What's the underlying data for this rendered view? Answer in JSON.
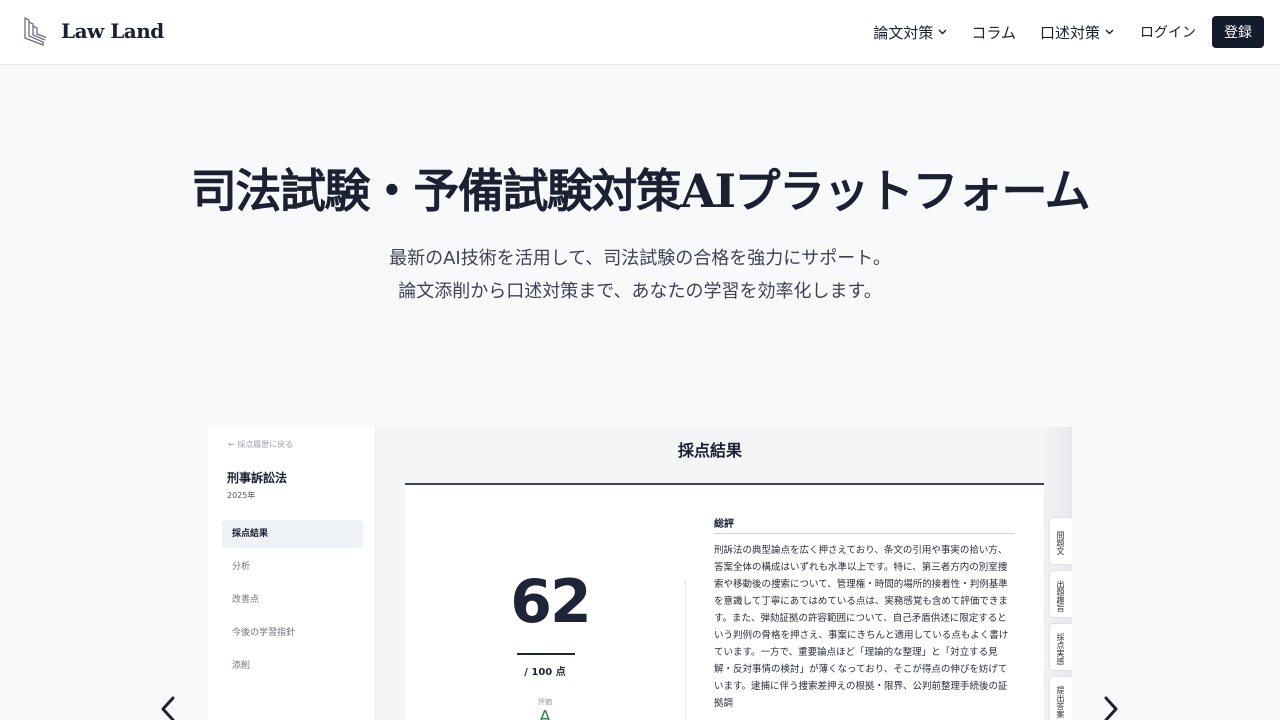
{
  "brand": {
    "name": "Law Land"
  },
  "nav": {
    "items": [
      {
        "label": "論文対策",
        "has_dropdown": true
      },
      {
        "label": "コラム",
        "has_dropdown": false
      },
      {
        "label": "口述対策",
        "has_dropdown": true
      }
    ],
    "login_label": "ログイン",
    "register_label": "登録"
  },
  "hero": {
    "title": "司法試験・予備試験対策AIプラットフォーム",
    "subtitle_line1": "最新のAI技術を活用して、司法試験の合格を強力にサポート。",
    "subtitle_line2": "論文添削から口述対策まで、あなたの学習を効率化します。"
  },
  "preview": {
    "back_label": "採点履歴に戻る",
    "subject": "刑事訴訟法",
    "year": "2025年",
    "menu": [
      {
        "label": "採点結果",
        "active": true
      },
      {
        "label": "分析",
        "active": false
      },
      {
        "label": "改善点",
        "active": false
      },
      {
        "label": "今後の学習指針",
        "active": false
      },
      {
        "label": "添削",
        "active": false
      }
    ],
    "header_title": "採点結果",
    "score": "62",
    "score_out_of": "/ 100 点",
    "evaluation_label": "評価",
    "evaluation_grade": "A",
    "summary_title": "総評",
    "summary_text": "刑訴法の典型論点を広く押さえており、条文の引用や事実の拾い方、答案全体の構成はいずれも水準以上です。特に、第三者方内の別室捜索や移動後の捜索について、管理権・時間的場所的接着性・判例基準を意識して丁寧にあてはめている点は、実務感覚も含めて評価できます。また、弾劾証拠の許容範囲について、自己矛盾供述に限定するという判例の骨格を押さえ、事案にきちんと適用している点もよく書けています。一方で、重要論点ほど「理論的な整理」と「対立する見解・反対事情の検討」が薄くなっており、そこが得点の伸びを妨げています。逮捕に伴う捜索差押えの根拠・限界、公判前整理手続後の証拠調",
    "side_tabs": [
      "問題文",
      "出題趣旨",
      "採点実感",
      "提出答案"
    ]
  },
  "colors": {
    "primary_dark": "#141b2d",
    "page_bg": "#f8f9fb",
    "grade_green": "#2e8a52"
  },
  "icons": {
    "logo": "layered-l-logo-icon",
    "dropdown": "chevron-down-icon",
    "back": "arrow-left-icon",
    "carousel_prev": "chevron-left-icon",
    "carousel_next": "chevron-right-icon"
  }
}
